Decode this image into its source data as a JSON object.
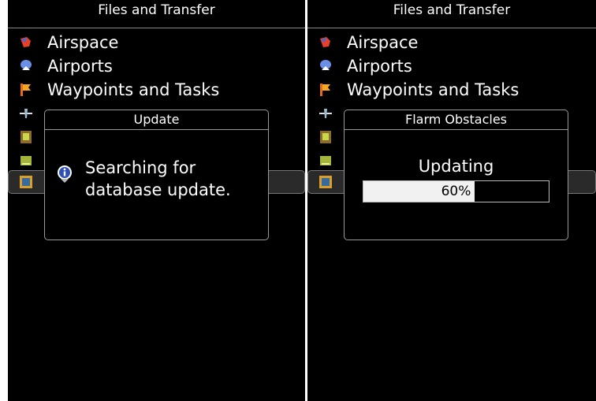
{
  "left": {
    "title": "Files and Transfer",
    "menu": [
      {
        "label": "Airspace",
        "icon": "airspace-icon"
      },
      {
        "label": "Airports",
        "icon": "airport-icon"
      },
      {
        "label": "Waypoints and Tasks",
        "icon": "waypoint-flag-icon"
      }
    ],
    "dialog": {
      "title": "Update",
      "message": "Searching for database update.",
      "icon": "info-icon"
    }
  },
  "right": {
    "title": "Files and Transfer",
    "menu": [
      {
        "label": "Airspace",
        "icon": "airspace-icon"
      },
      {
        "label": "Airports",
        "icon": "airport-icon"
      },
      {
        "label": "Waypoints and Tasks",
        "icon": "waypoint-flag-icon"
      }
    ],
    "dialog": {
      "title": "Flarm Obstacles",
      "status": "Updating",
      "progress_label": "60%",
      "progress_fraction": 0.6
    }
  },
  "colors": {
    "background": "#000000",
    "text": "#ffffff",
    "border": "#9a9a9a",
    "progress_fill": "#f1f1f1"
  }
}
